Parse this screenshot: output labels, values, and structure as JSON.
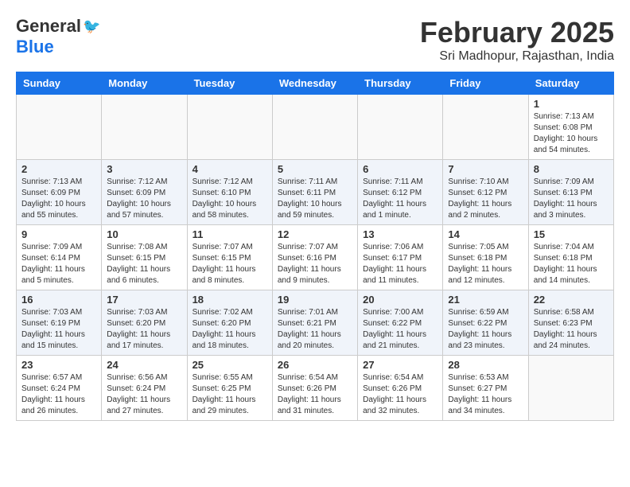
{
  "header": {
    "logo_general": "General",
    "logo_blue": "Blue",
    "title": "February 2025",
    "subtitle": "Sri Madhopur, Rajasthan, India"
  },
  "days_of_week": [
    "Sunday",
    "Monday",
    "Tuesday",
    "Wednesday",
    "Thursday",
    "Friday",
    "Saturday"
  ],
  "weeks": [
    [
      {
        "day": "",
        "empty": true
      },
      {
        "day": "",
        "empty": true
      },
      {
        "day": "",
        "empty": true
      },
      {
        "day": "",
        "empty": true
      },
      {
        "day": "",
        "empty": true
      },
      {
        "day": "",
        "empty": true
      },
      {
        "day": "1",
        "info": "Sunrise: 7:13 AM\nSunset: 6:08 PM\nDaylight: 10 hours\nand 54 minutes."
      }
    ],
    [
      {
        "day": "2",
        "info": "Sunrise: 7:13 AM\nSunset: 6:09 PM\nDaylight: 10 hours\nand 55 minutes."
      },
      {
        "day": "3",
        "info": "Sunrise: 7:12 AM\nSunset: 6:09 PM\nDaylight: 10 hours\nand 57 minutes."
      },
      {
        "day": "4",
        "info": "Sunrise: 7:12 AM\nSunset: 6:10 PM\nDaylight: 10 hours\nand 58 minutes."
      },
      {
        "day": "5",
        "info": "Sunrise: 7:11 AM\nSunset: 6:11 PM\nDaylight: 10 hours\nand 59 minutes."
      },
      {
        "day": "6",
        "info": "Sunrise: 7:11 AM\nSunset: 6:12 PM\nDaylight: 11 hours\nand 1 minute."
      },
      {
        "day": "7",
        "info": "Sunrise: 7:10 AM\nSunset: 6:12 PM\nDaylight: 11 hours\nand 2 minutes."
      },
      {
        "day": "8",
        "info": "Sunrise: 7:09 AM\nSunset: 6:13 PM\nDaylight: 11 hours\nand 3 minutes."
      }
    ],
    [
      {
        "day": "9",
        "info": "Sunrise: 7:09 AM\nSunset: 6:14 PM\nDaylight: 11 hours\nand 5 minutes."
      },
      {
        "day": "10",
        "info": "Sunrise: 7:08 AM\nSunset: 6:15 PM\nDaylight: 11 hours\nand 6 minutes."
      },
      {
        "day": "11",
        "info": "Sunrise: 7:07 AM\nSunset: 6:15 PM\nDaylight: 11 hours\nand 8 minutes."
      },
      {
        "day": "12",
        "info": "Sunrise: 7:07 AM\nSunset: 6:16 PM\nDaylight: 11 hours\nand 9 minutes."
      },
      {
        "day": "13",
        "info": "Sunrise: 7:06 AM\nSunset: 6:17 PM\nDaylight: 11 hours\nand 11 minutes."
      },
      {
        "day": "14",
        "info": "Sunrise: 7:05 AM\nSunset: 6:18 PM\nDaylight: 11 hours\nand 12 minutes."
      },
      {
        "day": "15",
        "info": "Sunrise: 7:04 AM\nSunset: 6:18 PM\nDaylight: 11 hours\nand 14 minutes."
      }
    ],
    [
      {
        "day": "16",
        "info": "Sunrise: 7:03 AM\nSunset: 6:19 PM\nDaylight: 11 hours\nand 15 minutes."
      },
      {
        "day": "17",
        "info": "Sunrise: 7:03 AM\nSunset: 6:20 PM\nDaylight: 11 hours\nand 17 minutes."
      },
      {
        "day": "18",
        "info": "Sunrise: 7:02 AM\nSunset: 6:20 PM\nDaylight: 11 hours\nand 18 minutes."
      },
      {
        "day": "19",
        "info": "Sunrise: 7:01 AM\nSunset: 6:21 PM\nDaylight: 11 hours\nand 20 minutes."
      },
      {
        "day": "20",
        "info": "Sunrise: 7:00 AM\nSunset: 6:22 PM\nDaylight: 11 hours\nand 21 minutes."
      },
      {
        "day": "21",
        "info": "Sunrise: 6:59 AM\nSunset: 6:22 PM\nDaylight: 11 hours\nand 23 minutes."
      },
      {
        "day": "22",
        "info": "Sunrise: 6:58 AM\nSunset: 6:23 PM\nDaylight: 11 hours\nand 24 minutes."
      }
    ],
    [
      {
        "day": "23",
        "info": "Sunrise: 6:57 AM\nSunset: 6:24 PM\nDaylight: 11 hours\nand 26 minutes."
      },
      {
        "day": "24",
        "info": "Sunrise: 6:56 AM\nSunset: 6:24 PM\nDaylight: 11 hours\nand 27 minutes."
      },
      {
        "day": "25",
        "info": "Sunrise: 6:55 AM\nSunset: 6:25 PM\nDaylight: 11 hours\nand 29 minutes."
      },
      {
        "day": "26",
        "info": "Sunrise: 6:54 AM\nSunset: 6:26 PM\nDaylight: 11 hours\nand 31 minutes."
      },
      {
        "day": "27",
        "info": "Sunrise: 6:54 AM\nSunset: 6:26 PM\nDaylight: 11 hours\nand 32 minutes."
      },
      {
        "day": "28",
        "info": "Sunrise: 6:53 AM\nSunset: 6:27 PM\nDaylight: 11 hours\nand 34 minutes."
      },
      {
        "day": "",
        "empty": true
      }
    ]
  ]
}
